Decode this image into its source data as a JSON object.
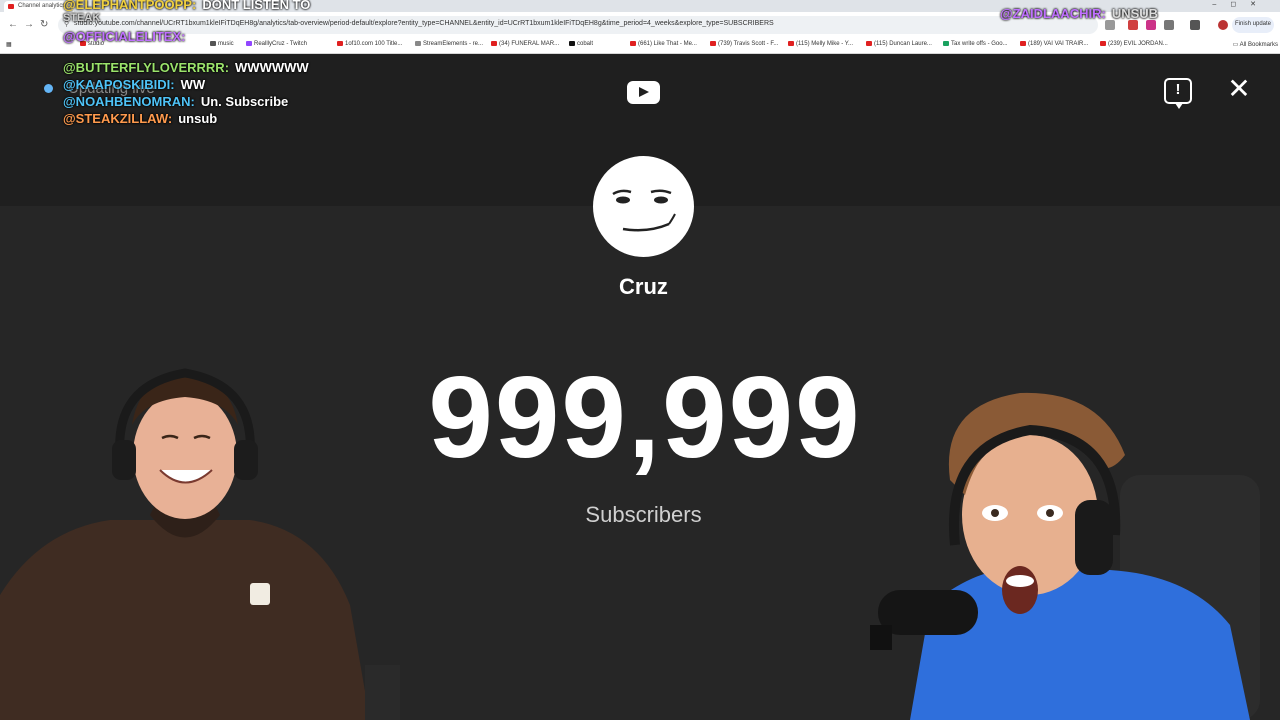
{
  "browser": {
    "tab_title": "Channel analytics",
    "address_url": "studio.youtube.com/channel/UCrRT1bxum1kleIFiTDqEH8g/analytics/tab-overview/period-default/explore?entity_type=CHANNEL&entity_id=UCrRT1bxum1kleIFiTDqEH8g&time_period=4_weeks&explore_type=SUBSCRIBERS",
    "finish_update_label": "Finish update",
    "all_bookmarks_label": "All Bookmarks",
    "bookmarks": [
      "studio",
      "music",
      "RealllyCruz - Twitch",
      "1of10.com 100 Title...",
      "StreamElements - re...",
      "(34) FUNERAL MAR...",
      "cobalt",
      "(661) Like That - Me...",
      "(739) Travis Scott - F...",
      "(115) Melly Mike - Y...",
      "(115) Duncan Laure...",
      "Tax write offs - Goo...",
      "(189) VAI VAI TRAIR...",
      "(239) EVIL JORDAN..."
    ]
  },
  "counter": {
    "status_text": "Updating live",
    "channel_name": "Cruz",
    "subscriber_count": "999,999",
    "subscriber_label": "Subscribers"
  },
  "chat": [
    {
      "user": "@ELEPHANTPOOPP:",
      "message": "DONT LISTEN TO",
      "color": "#f0d040"
    },
    {
      "user": "@OFFICIALELITEX:",
      "message": "",
      "color": "#c070ff"
    },
    {
      "user": "@BUTTERFLYLOVERRRR:",
      "message": "WWWWWW",
      "color": "#9be36b"
    },
    {
      "user": "@KAAPOSKIBIDI:",
      "message": "WW",
      "color": "#4fc3f7"
    },
    {
      "user": "@NOAHBENOMRAN:",
      "message": "Un. Subscribe",
      "color": "#4fc3f7"
    },
    {
      "user": "@STEAKZILLAW:",
      "message": "unsub",
      "color": "#ff9a4d"
    },
    {
      "user": "@ZAIDLAACHIR:",
      "message": "UNSUB",
      "color": "#c070ff"
    }
  ],
  "chat_partial": "STEAK",
  "colors": {
    "page_bg": "#1f1f1f",
    "band_bg": "#262626",
    "live_dot": "#64b5f6",
    "yt_red": "#e02020"
  }
}
